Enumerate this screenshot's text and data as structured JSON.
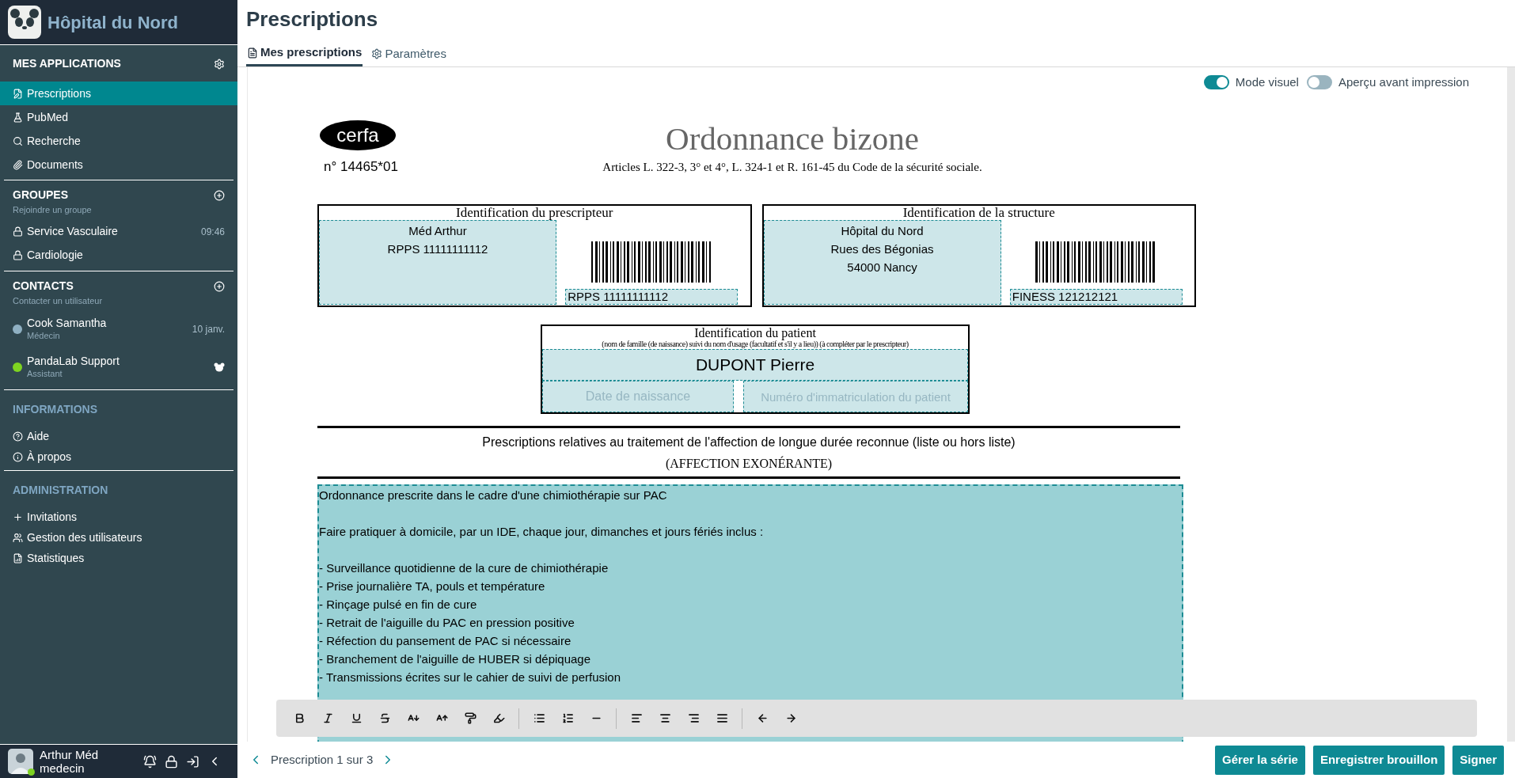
{
  "sidebar": {
    "brand": "Hôpital du Nord",
    "sections": [
      {
        "kind": "apps",
        "title": "MES APPLICATIONS",
        "muted": false,
        "items": [
          {
            "label": "Prescriptions",
            "selected": true
          },
          {
            "label": "PubMed",
            "selected": false
          },
          {
            "label": "Recherche",
            "selected": false
          },
          {
            "label": "Documents",
            "selected": false
          }
        ]
      },
      {
        "kind": "groups",
        "title": "GROUPES",
        "subtitle": "Rejoindre un groupe",
        "muted": false,
        "items": [
          {
            "label": "Service Vasculaire",
            "meta": "09:46",
            "selected": false
          },
          {
            "label": "Cardiologie",
            "selected": false
          }
        ]
      },
      {
        "kind": "contacts",
        "title": "CONTACTS",
        "subtitle": "Contacter un utilisateur",
        "muted": false,
        "items": [
          {
            "label": "Cook Samantha",
            "role": "Médecin",
            "meta": "10 janv.",
            "color": "#8fb0c2",
            "selected": false
          },
          {
            "label": "PandaLab Support",
            "role": "Assistant",
            "color": "#7ed321",
            "selected": false
          }
        ]
      },
      {
        "kind": "info",
        "title": "INFORMATIONS",
        "muted": true,
        "items": [
          {
            "label": "Aide",
            "selected": false
          },
          {
            "label": "À propos",
            "selected": false
          }
        ]
      },
      {
        "kind": "admin",
        "title": "ADMINISTRATION",
        "muted": true,
        "items": [
          {
            "label": "Invitations",
            "selected": false
          },
          {
            "label": "Gestion des utilisateurs",
            "selected": false
          },
          {
            "label": "Statistiques",
            "selected": false
          }
        ]
      }
    ],
    "user": {
      "name": "Arthur Méd",
      "role": "medecin",
      "online": true
    }
  },
  "page": {
    "title": "Prescriptions",
    "tabs": [
      {
        "label": "Mes prescriptions",
        "selected": true
      },
      {
        "label": "Paramètres",
        "selected": false
      }
    ],
    "toggles": [
      {
        "label": "Mode visuel",
        "on": true
      },
      {
        "label": "Aperçu avant impression",
        "on": false
      }
    ]
  },
  "form": {
    "logo": "cerfa",
    "number": "n° 14465*01",
    "title": "Ordonnance bizone",
    "subtitle": "Articles L. 322-3, 3° et 4°, L. 324-1 et R. 161-45 du Code de la sécurité sociale.",
    "prescriber": {
      "heading": "Identification du prescripteur",
      "lines": [
        "Méd Arthur",
        "RPPS 11111111112"
      ],
      "code": "RPPS 11111111112"
    },
    "structure": {
      "heading": "Identification de la structure",
      "lines": [
        "Hôpital du Nord",
        "Rues des Bégonias",
        "54000 Nancy"
      ],
      "code": "FINESS 121212121"
    },
    "patient": {
      "heading": "Identification du patient",
      "note": "(nom de famille (de naissance) suivi du nom d'usage (facultatif et s'il y a lieu)) (à compléter par le prescripteur)",
      "name": "DUPONT Pierre",
      "birth_placeholder": "Date de naissance",
      "number_placeholder": "Numéro d'immatriculation du patient"
    },
    "section_heading": "Prescriptions relatives au traitement de l'affection de longue durée reconnue (liste ou hors liste)",
    "section_subheading": "(AFFECTION EXONÉRANTE)",
    "paragraphs": [
      "Ordonnance prescrite dans le cadre d'une chimiothérapie sur PAC",
      "Faire pratiquer à domicile, par un IDE, chaque jour, dimanches et jours fériés inclus :"
    ],
    "bullets": [
      "- Surveillance quotidienne de la cure de chimiothérapie",
      "- Prise journalière TA, pouls et température",
      "- Rinçage pulsé en fin de cure",
      "- Retrait de l'aiguille du PAC en pression positive",
      "- Réfection du pansement de PAC si nécessaire",
      "- Branchement de l'aiguille de HUBER si dépiquage",
      "- Transmissions écrites sur le cahier de suivi de perfusion"
    ]
  },
  "pager": "Prescription 1 sur 3",
  "buttons": [
    "Gérer la série",
    "Enregistrer brouillon",
    "Signer"
  ]
}
